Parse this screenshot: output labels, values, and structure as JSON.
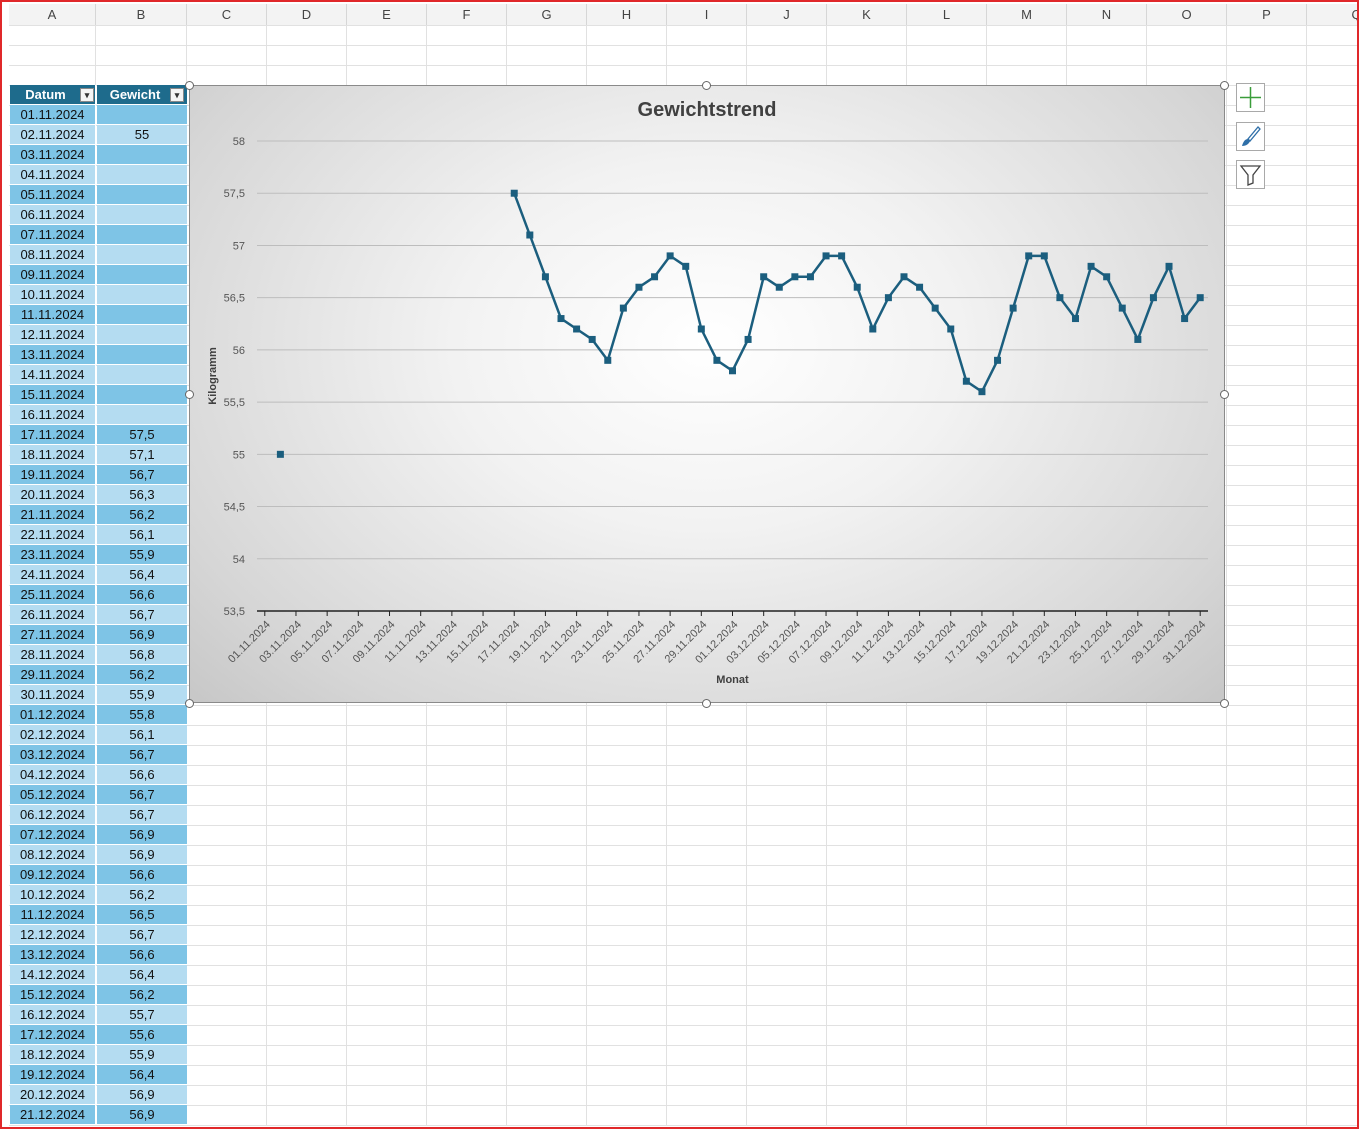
{
  "columns": [
    "A",
    "B",
    "C",
    "D",
    "E",
    "F",
    "G",
    "H",
    "I",
    "J",
    "K",
    "L",
    "M",
    "N",
    "O",
    "P",
    "Q"
  ],
  "table": {
    "headers": [
      "Datum",
      "Gewicht"
    ],
    "rows": [
      [
        "01.11.2024",
        ""
      ],
      [
        "02.11.2024",
        "55"
      ],
      [
        "03.11.2024",
        ""
      ],
      [
        "04.11.2024",
        ""
      ],
      [
        "05.11.2024",
        ""
      ],
      [
        "06.11.2024",
        ""
      ],
      [
        "07.11.2024",
        ""
      ],
      [
        "08.11.2024",
        ""
      ],
      [
        "09.11.2024",
        ""
      ],
      [
        "10.11.2024",
        ""
      ],
      [
        "11.11.2024",
        ""
      ],
      [
        "12.11.2024",
        ""
      ],
      [
        "13.11.2024",
        ""
      ],
      [
        "14.11.2024",
        ""
      ],
      [
        "15.11.2024",
        ""
      ],
      [
        "16.11.2024",
        ""
      ],
      [
        "17.11.2024",
        "57,5"
      ],
      [
        "18.11.2024",
        "57,1"
      ],
      [
        "19.11.2024",
        "56,7"
      ],
      [
        "20.11.2024",
        "56,3"
      ],
      [
        "21.11.2024",
        "56,2"
      ],
      [
        "22.11.2024",
        "56,1"
      ],
      [
        "23.11.2024",
        "55,9"
      ],
      [
        "24.11.2024",
        "56,4"
      ],
      [
        "25.11.2024",
        "56,6"
      ],
      [
        "26.11.2024",
        "56,7"
      ],
      [
        "27.11.2024",
        "56,9"
      ],
      [
        "28.11.2024",
        "56,8"
      ],
      [
        "29.11.2024",
        "56,2"
      ],
      [
        "30.11.2024",
        "55,9"
      ],
      [
        "01.12.2024",
        "55,8"
      ],
      [
        "02.12.2024",
        "56,1"
      ],
      [
        "03.12.2024",
        "56,7"
      ],
      [
        "04.12.2024",
        "56,6"
      ],
      [
        "05.12.2024",
        "56,7"
      ],
      [
        "06.12.2024",
        "56,7"
      ],
      [
        "07.12.2024",
        "56,9"
      ],
      [
        "08.12.2024",
        "56,9"
      ],
      [
        "09.12.2024",
        "56,6"
      ],
      [
        "10.12.2024",
        "56,2"
      ],
      [
        "11.12.2024",
        "56,5"
      ],
      [
        "12.12.2024",
        "56,7"
      ],
      [
        "13.12.2024",
        "56,6"
      ],
      [
        "14.12.2024",
        "56,4"
      ],
      [
        "15.12.2024",
        "56,2"
      ],
      [
        "16.12.2024",
        "55,7"
      ],
      [
        "17.12.2024",
        "55,6"
      ],
      [
        "18.12.2024",
        "55,9"
      ],
      [
        "19.12.2024",
        "56,4"
      ],
      [
        "20.12.2024",
        "56,9"
      ],
      [
        "21.12.2024",
        "56,9"
      ]
    ]
  },
  "colors": {
    "header": "#1e6b8c",
    "row_dark": "#7ec4e6",
    "row_light": "#b4dcf1",
    "series": "#1b5e7e"
  },
  "side_buttons": [
    "chart-elements-icon",
    "chart-styles-icon",
    "chart-filters-icon"
  ],
  "chart_data": {
    "type": "line",
    "title": "Gewichtstrend",
    "xlabel": "Monat",
    "ylabel": "Kilogramm",
    "ylim": [
      53.5,
      58
    ],
    "ytick_step": 0.5,
    "yticks": [
      "53,5",
      "54",
      "54,5",
      "55",
      "55,5",
      "56",
      "56,5",
      "57",
      "57,5",
      "58"
    ],
    "grid": true,
    "legend": "none",
    "x": [
      "01.11.2024",
      "02.11.2024",
      "03.11.2024",
      "04.11.2024",
      "05.11.2024",
      "06.11.2024",
      "07.11.2024",
      "08.11.2024",
      "09.11.2024",
      "10.11.2024",
      "11.11.2024",
      "12.11.2024",
      "13.11.2024",
      "14.11.2024",
      "15.11.2024",
      "16.11.2024",
      "17.11.2024",
      "18.11.2024",
      "19.11.2024",
      "20.11.2024",
      "21.11.2024",
      "22.11.2024",
      "23.11.2024",
      "24.11.2024",
      "25.11.2024",
      "26.11.2024",
      "27.11.2024",
      "28.11.2024",
      "29.11.2024",
      "30.11.2024",
      "01.12.2024",
      "02.12.2024",
      "03.12.2024",
      "04.12.2024",
      "05.12.2024",
      "06.12.2024",
      "07.12.2024",
      "08.12.2024",
      "09.12.2024",
      "10.12.2024",
      "11.12.2024",
      "12.12.2024",
      "13.12.2024",
      "14.12.2024",
      "15.12.2024",
      "16.12.2024",
      "17.12.2024",
      "18.12.2024",
      "19.12.2024",
      "20.12.2024",
      "21.12.2024",
      "22.12.2024",
      "23.12.2024",
      "24.12.2024",
      "25.12.2024",
      "26.12.2024",
      "27.12.2024",
      "28.12.2024",
      "29.12.2024",
      "30.12.2024",
      "31.12.2024"
    ],
    "xtick_labels": [
      "01.11.2024",
      "03.11.2024",
      "05.11.2024",
      "07.11.2024",
      "09.11.2024",
      "11.11.2024",
      "13.11.2024",
      "15.11.2024",
      "17.11.2024",
      "19.11.2024",
      "21.11.2024",
      "23.11.2024",
      "25.11.2024",
      "27.11.2024",
      "29.11.2024",
      "01.12.2024",
      "03.12.2024",
      "05.12.2024",
      "07.12.2024",
      "09.12.2024",
      "11.12.2024",
      "13.12.2024",
      "15.12.2024",
      "17.12.2024",
      "19.12.2024",
      "21.12.2024",
      "23.12.2024",
      "25.12.2024",
      "27.12.2024",
      "29.12.2024",
      "31.12.2024"
    ],
    "values": [
      null,
      55,
      null,
      null,
      null,
      null,
      null,
      null,
      null,
      null,
      null,
      null,
      null,
      null,
      null,
      null,
      57.5,
      57.1,
      56.7,
      56.3,
      56.2,
      56.1,
      55.9,
      56.4,
      56.6,
      56.7,
      56.9,
      56.8,
      56.2,
      55.9,
      55.8,
      56.1,
      56.7,
      56.6,
      56.7,
      56.7,
      56.9,
      56.9,
      56.6,
      56.2,
      56.5,
      56.7,
      56.6,
      56.4,
      56.2,
      55.7,
      55.6,
      55.9,
      56.4,
      56.9,
      56.9,
      56.5,
      56.3,
      56.8,
      56.7,
      56.4,
      56.1,
      56.5,
      56.8,
      56.3,
      56.5
    ]
  }
}
